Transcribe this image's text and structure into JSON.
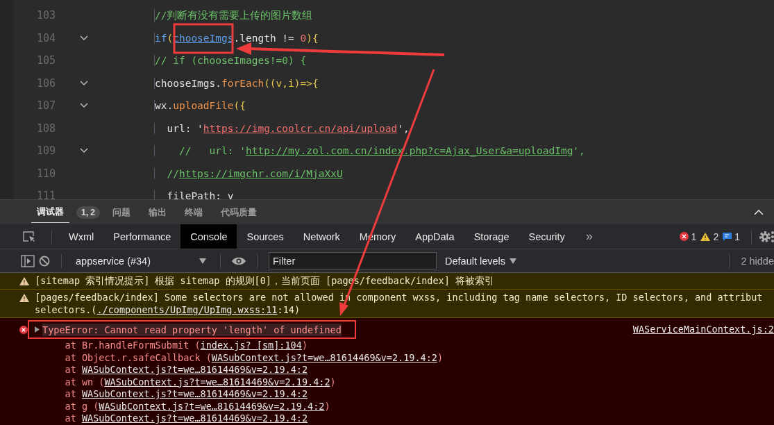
{
  "editor": {
    "lines": [
      {
        "number": "103",
        "foldable": false,
        "tokens": [
          {
            "kind": "comment",
            "text": "//判断有没有需要上传的图片数组"
          }
        ]
      },
      {
        "number": "104",
        "foldable": true,
        "tokens": [
          {
            "kind": "keyword",
            "text": "if"
          },
          {
            "kind": "bracket",
            "text": "("
          },
          {
            "kind": "var-link",
            "text": "chooseImgs"
          },
          {
            "kind": "plain",
            "text": ".length != "
          },
          {
            "kind": "number",
            "text": "0"
          },
          {
            "kind": "bracket",
            "text": "){"
          }
        ]
      },
      {
        "number": "105",
        "foldable": false,
        "tokens": [
          {
            "kind": "comment",
            "text": "// if (chooseImages!=0) {"
          }
        ]
      },
      {
        "number": "106",
        "foldable": true,
        "tokens": [
          {
            "kind": "plain",
            "text": "chooseImgs."
          },
          {
            "kind": "func",
            "text": "forEach"
          },
          {
            "kind": "bracket",
            "text": "((v,i)=>{"
          }
        ]
      },
      {
        "number": "107",
        "foldable": true,
        "tokens": [
          {
            "kind": "plain",
            "text": "wx."
          },
          {
            "kind": "func",
            "text": "uploadFile"
          },
          {
            "kind": "bracket",
            "text": "({"
          }
        ]
      },
      {
        "number": "108",
        "foldable": false,
        "tokens": [
          {
            "kind": "plain",
            "text": "  url: '"
          },
          {
            "kind": "string-link",
            "text": "https://img.coolcr.cn/api/upload"
          },
          {
            "kind": "plain",
            "text": "',"
          }
        ]
      },
      {
        "number": "109",
        "foldable": true,
        "tokens": [
          {
            "kind": "comment",
            "text": "    //   url: '"
          },
          {
            "kind": "comment-link",
            "text": "http://my.zol.com.cn/index.php?c=Ajax_User&a=uploadImg"
          },
          {
            "kind": "comment",
            "text": "',"
          }
        ]
      },
      {
        "number": "110",
        "foldable": false,
        "tokens": [
          {
            "kind": "comment",
            "text": "  //"
          },
          {
            "kind": "comment-link",
            "text": "https://imgchr.com/i/MjaXxU"
          }
        ]
      },
      {
        "number": "111",
        "foldable": false,
        "tokens": [
          {
            "kind": "plain",
            "text": "  filePath: v"
          }
        ]
      }
    ]
  },
  "panel_tabs": [
    {
      "label": "调试器",
      "selected": true,
      "badge": "1, 2"
    },
    {
      "label": "问题",
      "selected": false
    },
    {
      "label": "输出",
      "selected": false
    },
    {
      "label": "终端",
      "selected": false
    },
    {
      "label": "代码质量",
      "selected": false
    }
  ],
  "devtools_tabs": [
    {
      "label": "Wxml",
      "selected": false
    },
    {
      "label": "Performance",
      "selected": false
    },
    {
      "label": "Console",
      "selected": true
    },
    {
      "label": "Sources",
      "selected": false
    },
    {
      "label": "Network",
      "selected": false
    },
    {
      "label": "Memory",
      "selected": false
    },
    {
      "label": "AppData",
      "selected": false
    },
    {
      "label": "Storage",
      "selected": false
    },
    {
      "label": "Security",
      "selected": false
    }
  ],
  "more_tabs": "»",
  "counts": {
    "errors": "1",
    "warnings": "2",
    "info": "1"
  },
  "toolbar": {
    "context": "appservice (#34)",
    "filter_placeholder": "Filter",
    "levels": "Default levels",
    "hidden": "2 hidde"
  },
  "messages": [
    {
      "kind": "warning",
      "lines": [
        {
          "parts": [
            {
              "text": "[sitemap 索引情况提示] 根据 sitemap 的规则[0]，当前页面 [pages/feedback/index] 将被索引"
            }
          ]
        }
      ]
    },
    {
      "kind": "warning",
      "lines": [
        {
          "parts": [
            {
              "text": "[pages/feedback/index] Some selectors are not allowed in component wxss, including tag name selectors, ID selectors, and attribut"
            }
          ]
        },
        {
          "parts": [
            {
              "text": "selectors.("
            },
            {
              "text": "./components/UpImg/UpImg.wxss:11",
              "link": true
            },
            {
              "text": ":14)"
            }
          ]
        }
      ]
    },
    {
      "kind": "error",
      "source": "WAServiceMainContext.js:2",
      "lines": [
        {
          "parts": [
            {
              "text": "TypeError: Cannot read property 'length' of undefined"
            }
          ]
        },
        {
          "parts": [
            {
              "text": "    at Br.handleFormSubmit ("
            },
            {
              "text": "index.js? [sm]:104",
              "link": true
            },
            {
              "text": ")"
            }
          ]
        },
        {
          "parts": [
            {
              "text": "    at Object.r.safeCallback ("
            },
            {
              "text": "WASubContext.js?t=we…81614469&v=2.19.4:2",
              "link": true
            },
            {
              "text": ")"
            }
          ]
        },
        {
          "parts": [
            {
              "text": "    at "
            },
            {
              "text": "WASubContext.js?t=we…81614469&v=2.19.4:2",
              "link": true
            }
          ]
        },
        {
          "parts": [
            {
              "text": "    at wn ("
            },
            {
              "text": "WASubContext.js?t=we…81614469&v=2.19.4:2",
              "link": true
            },
            {
              "text": ")"
            }
          ]
        },
        {
          "parts": [
            {
              "text": "    at "
            },
            {
              "text": "WASubContext.js?t=we…81614469&v=2.19.4:2",
              "link": true
            }
          ]
        },
        {
          "parts": [
            {
              "text": "    at g ("
            },
            {
              "text": "WASubContext.js?t=we…81614469&v=2.19.4:2",
              "link": true
            },
            {
              "text": ")"
            }
          ]
        },
        {
          "parts": [
            {
              "text": "    at "
            },
            {
              "text": "WASubContext.js?t=we…81614469&v=2.19.4:2",
              "link": true
            }
          ]
        }
      ]
    }
  ]
}
